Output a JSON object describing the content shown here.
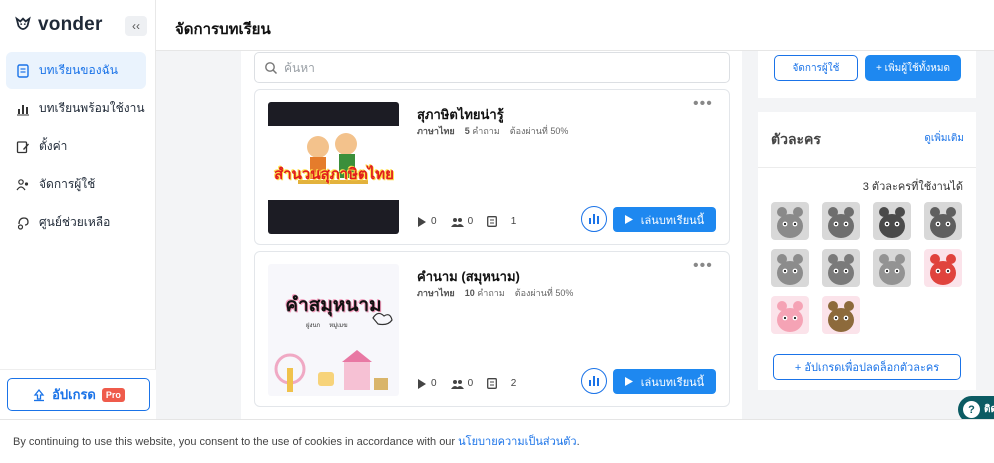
{
  "app": {
    "brand": "vonder",
    "collapse_label": "‹‹"
  },
  "sidebar": {
    "items": [
      {
        "label": "บทเรียนของฉัน",
        "icon": "document-icon",
        "active": true
      },
      {
        "label": "บทเรียนพร้อมใช้งาน",
        "icon": "bar-chart-icon",
        "active": false
      },
      {
        "label": "ตั้งค่า",
        "icon": "edit-icon",
        "active": false
      },
      {
        "label": "จัดการผู้ใช้",
        "icon": "users-icon",
        "active": false
      },
      {
        "label": "ศูนย์ช่วยเหลือ",
        "icon": "help-icon",
        "active": false
      }
    ],
    "upgrade_label": "อัปเกรด",
    "pro_badge": "Pro"
  },
  "header": {
    "title": "จัดการบทเรียน"
  },
  "search": {
    "placeholder": "ค้นหา"
  },
  "lessons": [
    {
      "title": "สุภาษิตไทยน่ารู้",
      "subject": "ภาษาไทย",
      "questions": "5",
      "questions_unit": "คำถาม",
      "pass": "ต้องผ่านที่ 50%",
      "plays": "0",
      "players": "0",
      "pages": "1",
      "thumb_text": "สำนวนสุภาษิตไทย",
      "play_label": "เล่นบทเรียนนี้"
    },
    {
      "title": "คำนาม (สมุหนาม)",
      "subject": "ภาษาไทย",
      "questions": "10",
      "questions_unit": "คำถาม",
      "pass": "ต้องผ่านที่ 50%",
      "plays": "0",
      "players": "0",
      "pages": "2",
      "thumb_text": "คำสมุหนาม",
      "thumb_sub1": "ฝูงนก",
      "thumb_sub2": "หมู่เมฆ",
      "play_label": "เล่นบทเรียนนี้"
    }
  ],
  "right": {
    "manage_users": "จัดการผู้ใช้",
    "add_all_users": "+ เพิ่มผู้ใช้ทั้งหมด",
    "characters_title": "ตัวละคร",
    "see_more": "ดูเพิ่มเติม",
    "characters_count": "3 ตัวละครที่ใช้งานได้",
    "unlock_label": "+ อัปเกรดเพื่อปลดล็อกตัวละคร",
    "characters": [
      {
        "color": "#8a8a8a",
        "unlocked": false
      },
      {
        "color": "#6e6e6e",
        "unlocked": false
      },
      {
        "color": "#4a4a4a",
        "unlocked": false
      },
      {
        "color": "#5f5f5f",
        "unlocked": false
      },
      {
        "color": "#8c8c8c",
        "unlocked": false
      },
      {
        "color": "#7a7a7a",
        "unlocked": false
      },
      {
        "color": "#939393",
        "unlocked": false
      },
      {
        "color": "#e0433d",
        "unlocked": true
      },
      {
        "color": "#f5a3b5",
        "unlocked": true
      },
      {
        "color": "#8d6a3b",
        "unlocked": true
      }
    ]
  },
  "help_chip": "ติด",
  "cookie": {
    "text": "By continuing to use this website, you consent to the use of cookies in accordance with our ",
    "link": "นโยบายความเป็นส่วนตัว",
    "end": "."
  },
  "colors": {
    "accent": "#1a73e8",
    "button_fill": "#1e88f0",
    "pro_badge": "#ef5b4b",
    "help_chip": "#0b5b63"
  }
}
